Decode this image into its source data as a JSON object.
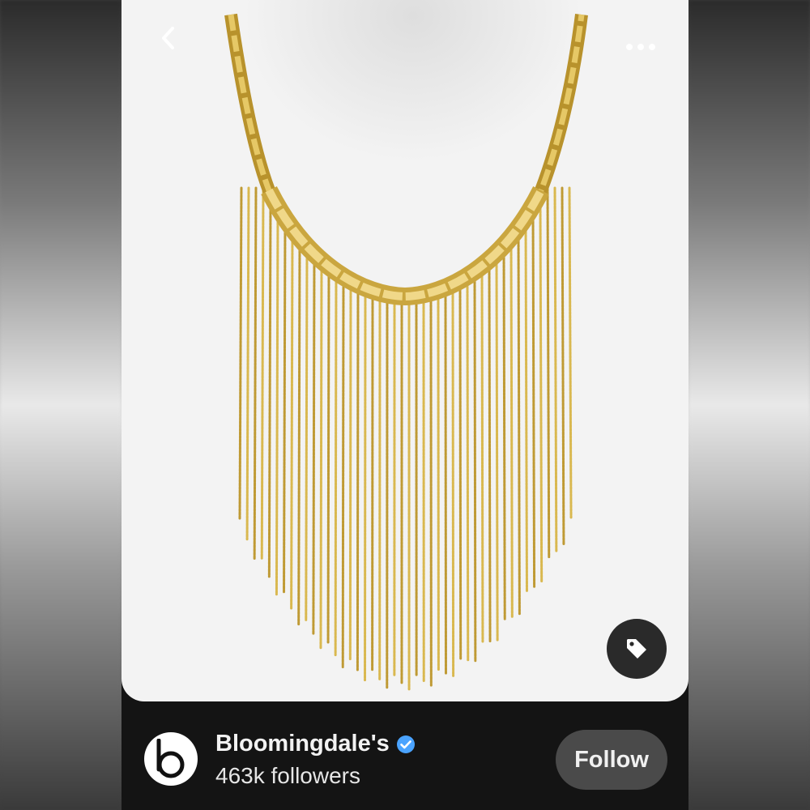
{
  "profile": {
    "name": "Bloomingdale's",
    "followers": "463k followers",
    "verified": true,
    "avatar_letter": "b"
  },
  "actions": {
    "follow_label": "Follow"
  },
  "icons": {
    "back": "chevron-left-icon",
    "more": "more-horizontal-icon",
    "tag": "tag-icon",
    "verified": "verified-badge-icon"
  },
  "colors": {
    "verified_blue": "#4aa3ff",
    "gold": "#c9a23a"
  }
}
